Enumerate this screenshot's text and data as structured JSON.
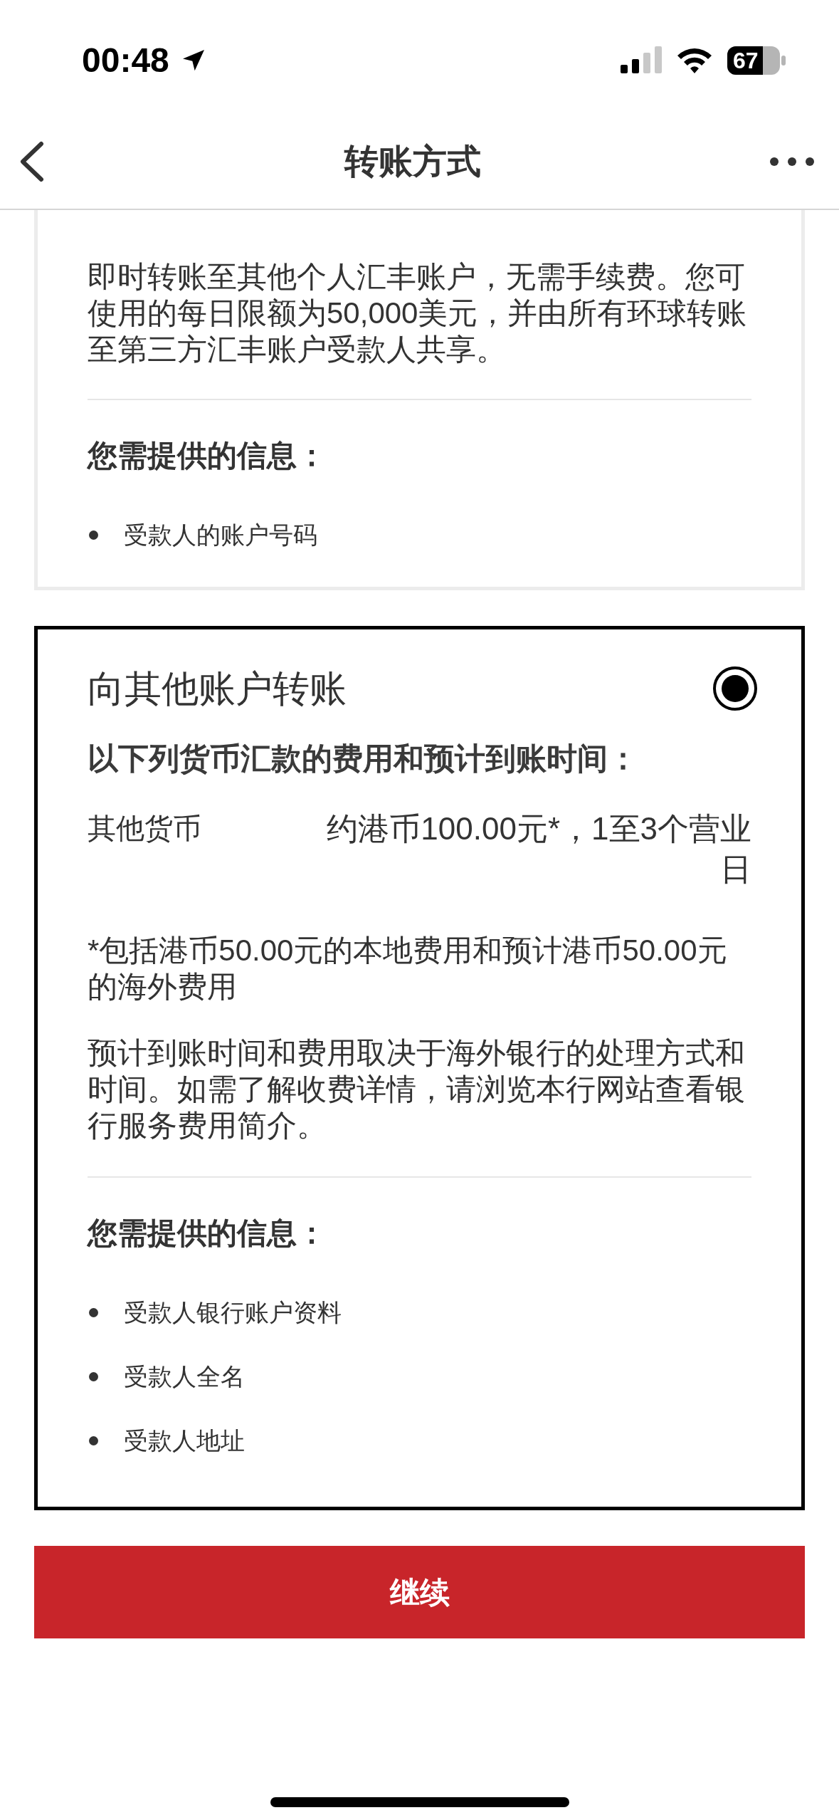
{
  "status_bar": {
    "time": "00:48",
    "battery": "67"
  },
  "nav": {
    "title": "转账方式"
  },
  "first_option": {
    "description": "即时转账至其他个人汇丰账户，无需手续费。您可使用的每日限额为50,000美元，并由所有环球转账至第三方汇丰账户受款人共享。",
    "info_heading": "您需提供的信息：",
    "info_items": [
      "受款人的账户号码"
    ]
  },
  "second_option": {
    "title": "向其他账户转账",
    "selected": true,
    "subtitle": "以下列货币汇款的费用和预计到账时间：",
    "fee_rows": [
      {
        "label": "其他货币",
        "value": "约港币100.00元*，1至3个营业日"
      }
    ],
    "footnote": "*包括港币50.00元的本地费用和预计港币50.00元的海外费用",
    "note": "预计到账时间和费用取决于海外银行的处理方式和时间。如需了解收费详情，请浏览本行网站查看银行服务费用简介。",
    "info_heading": "您需提供的信息：",
    "info_items": [
      "受款人银行账户资料",
      "受款人全名",
      "受款人地址"
    ]
  },
  "continue_button": "继续"
}
